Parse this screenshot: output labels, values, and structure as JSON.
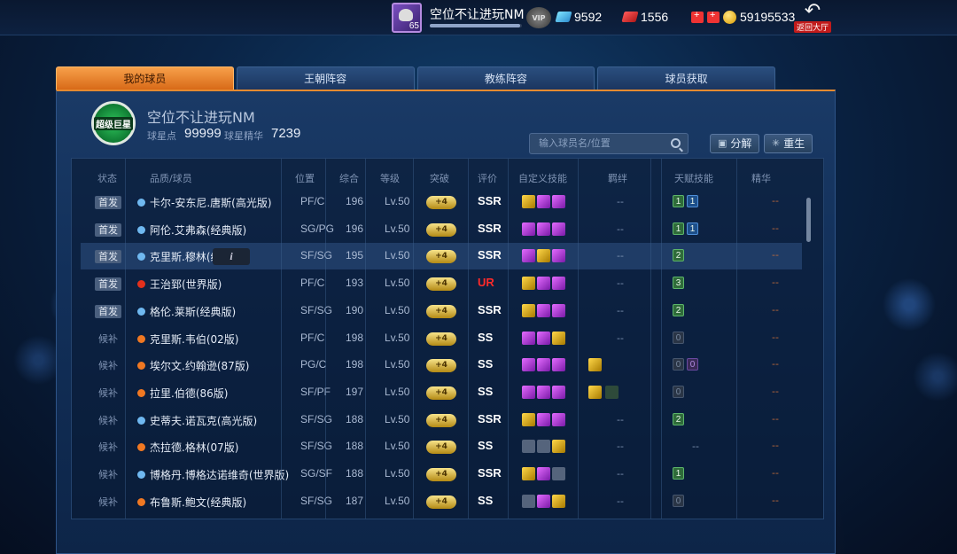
{
  "topbar": {
    "level": "65",
    "username": "空位不让进玩NM",
    "vip_label": "VIP",
    "diamonds": "9592",
    "tickets": "1556",
    "coins": "59195533",
    "back_label": "返回大厅",
    "xp_progress": 0.98
  },
  "tabs": [
    {
      "label": "我的球员",
      "active": true
    },
    {
      "label": "王朝阵容",
      "active": false
    },
    {
      "label": "教练阵容",
      "active": false
    },
    {
      "label": "球员获取",
      "active": false
    }
  ],
  "club": {
    "badge_text": "超级巨星",
    "name": "空位不让进玩NM",
    "star_points_label": "球星点",
    "star_points": "99999",
    "essence_label": "球星精华",
    "essence": "7239"
  },
  "search": {
    "placeholder": "输入球员名/位置"
  },
  "buttons": {
    "decompose": "分解",
    "rebirth": "重生"
  },
  "columns": [
    "状态",
    "品质/球员",
    "位置",
    "综合",
    "等级",
    "突破",
    "评价",
    "自定义技能",
    "羁绊",
    "天赋技能",
    "精华"
  ],
  "plus_label": "+4",
  "dash": "--",
  "colors": {
    "accent_orange": "#e58a30",
    "ur_red": "#ff2a2a",
    "quality_blue": "#6fb8f0",
    "quality_red": "#e2301c",
    "quality_orange": "#f07822"
  },
  "players": [
    {
      "status": "首发",
      "quality": "blue",
      "name": "卡尔-安东尼.唐斯(高光版)",
      "pos": "PF/C",
      "ovr": "196",
      "lv": "Lv.50",
      "grade": "SSR",
      "skills": [
        "gold",
        "purp",
        "purp"
      ],
      "bond": [],
      "talents": [
        {
          "t": "1",
          "c": "g"
        },
        {
          "t": "1",
          "c": "b"
        }
      ],
      "ess": "--"
    },
    {
      "status": "首发",
      "quality": "blue",
      "name": "阿伦.艾弗森(经典版)",
      "pos": "SG/PG",
      "ovr": "196",
      "lv": "Lv.50",
      "grade": "SSR",
      "skills": [
        "purp",
        "purp",
        "purp"
      ],
      "bond": [],
      "talents": [
        {
          "t": "1",
          "c": "g"
        },
        {
          "t": "1",
          "c": "b"
        }
      ],
      "ess": "--"
    },
    {
      "status": "首发",
      "quality": "blue",
      "name": "克里斯.穆林(经",
      "pos": "SF/SG",
      "ovr": "195",
      "lv": "Lv.50",
      "grade": "SSR",
      "skills": [
        "purp",
        "gold",
        "purp"
      ],
      "bond": [],
      "talents": [
        {
          "t": "2",
          "c": "g"
        }
      ],
      "ess": "--",
      "selected": true
    },
    {
      "status": "首发",
      "quality": "red",
      "name": "王治郅(世界版)",
      "pos": "PF/C",
      "ovr": "193",
      "lv": "Lv.50",
      "grade": "UR",
      "skills": [
        "gold",
        "purp",
        "purp"
      ],
      "bond": [],
      "talents": [
        {
          "t": "3",
          "c": "g"
        }
      ],
      "ess": "--"
    },
    {
      "status": "首发",
      "quality": "blue",
      "name": "格伦.莱斯(经典版)",
      "pos": "SF/SG",
      "ovr": "190",
      "lv": "Lv.50",
      "grade": "SSR",
      "skills": [
        "gold",
        "purp",
        "purp"
      ],
      "bond": [],
      "talents": [
        {
          "t": "2",
          "c": "g"
        }
      ],
      "ess": "--"
    },
    {
      "status": "候补",
      "quality": "orange",
      "name": "克里斯.韦伯(02版)",
      "pos": "PF/C",
      "ovr": "198",
      "lv": "Lv.50",
      "grade": "SS",
      "skills": [
        "purp",
        "purp",
        "gold"
      ],
      "bond": [],
      "talents": [
        {
          "t": "0",
          "c": "gray"
        }
      ],
      "ess": "--"
    },
    {
      "status": "候补",
      "quality": "orange",
      "name": "埃尔文.约翰逊(87版)",
      "pos": "PG/C",
      "ovr": "198",
      "lv": "Lv.50",
      "grade": "SS",
      "skills": [
        "purp",
        "purp",
        "purp"
      ],
      "bond": [
        "gold"
      ],
      "talents": [
        {
          "t": "0",
          "c": "gray"
        },
        {
          "t": "0",
          "c": "pu"
        }
      ],
      "ess": "--"
    },
    {
      "status": "候补",
      "quality": "orange",
      "name": "拉里.伯德(86版)",
      "pos": "SF/PF",
      "ovr": "197",
      "lv": "Lv.50",
      "grade": "SS",
      "skills": [
        "purp",
        "purp",
        "purp"
      ],
      "bond": [
        "gold",
        "dim"
      ],
      "talents": [
        {
          "t": "0",
          "c": "gray"
        }
      ],
      "ess": "--"
    },
    {
      "status": "候补",
      "quality": "blue",
      "name": "史蒂夫.诺瓦克(高光版)",
      "pos": "SF/SG",
      "ovr": "188",
      "lv": "Lv.50",
      "grade": "SSR",
      "skills": [
        "gold",
        "purp",
        "purp"
      ],
      "bond": [],
      "talents": [
        {
          "t": "2",
          "c": "g"
        }
      ],
      "ess": "--"
    },
    {
      "status": "候补",
      "quality": "orange",
      "name": "杰拉德.格林(07版)",
      "pos": "SF/SG",
      "ovr": "188",
      "lv": "Lv.50",
      "grade": "SS",
      "skills": [
        "grey",
        "grey",
        "gold"
      ],
      "bond": [],
      "talents": [],
      "ess": "--"
    },
    {
      "status": "候补",
      "quality": "blue",
      "name": "博格丹.博格达诺维奇(世界版)",
      "pos": "SG/SF",
      "ovr": "188",
      "lv": "Lv.50",
      "grade": "SSR",
      "skills": [
        "gold",
        "purp",
        "grey"
      ],
      "bond": [],
      "talents": [
        {
          "t": "1",
          "c": "g"
        }
      ],
      "ess": "--"
    },
    {
      "status": "候补",
      "quality": "orange",
      "name": "布鲁斯.鲍文(经典版)",
      "pos": "SF/SG",
      "ovr": "187",
      "lv": "Lv.50",
      "grade": "SS",
      "skills": [
        "grey",
        "purp",
        "gold"
      ],
      "bond": [],
      "talents": [
        {
          "t": "0",
          "c": "gray"
        }
      ],
      "ess": "--"
    }
  ]
}
